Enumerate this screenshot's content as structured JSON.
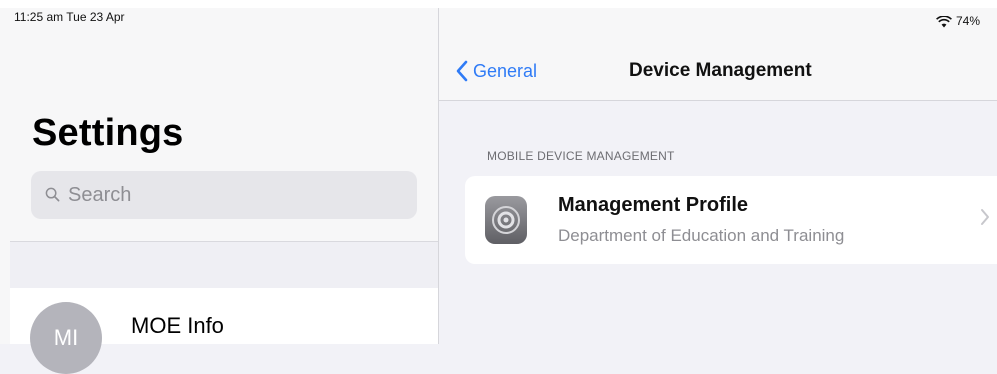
{
  "status_bar": {
    "time": "11:25 am  Tue 23 Apr",
    "battery": "74%"
  },
  "left_pane": {
    "title": "Settings",
    "search": {
      "placeholder": "Search"
    },
    "account": {
      "initials": "MI",
      "name": "MOE Info"
    }
  },
  "right_pane": {
    "nav": {
      "back_label": "General",
      "title": "Device Management"
    },
    "section_header": "MOBILE DEVICE MANAGEMENT",
    "profile": {
      "name": "Management Profile",
      "organization": "Department of Education and Training"
    }
  },
  "colors": {
    "accent": "#2f7bf6",
    "secondary_text": "#8e8e93",
    "background": "#f2f2f7"
  },
  "icons": [
    "search-icon",
    "wifi-icon",
    "back-chevron-icon",
    "settings-gear-icon",
    "chevron-right-icon"
  ]
}
